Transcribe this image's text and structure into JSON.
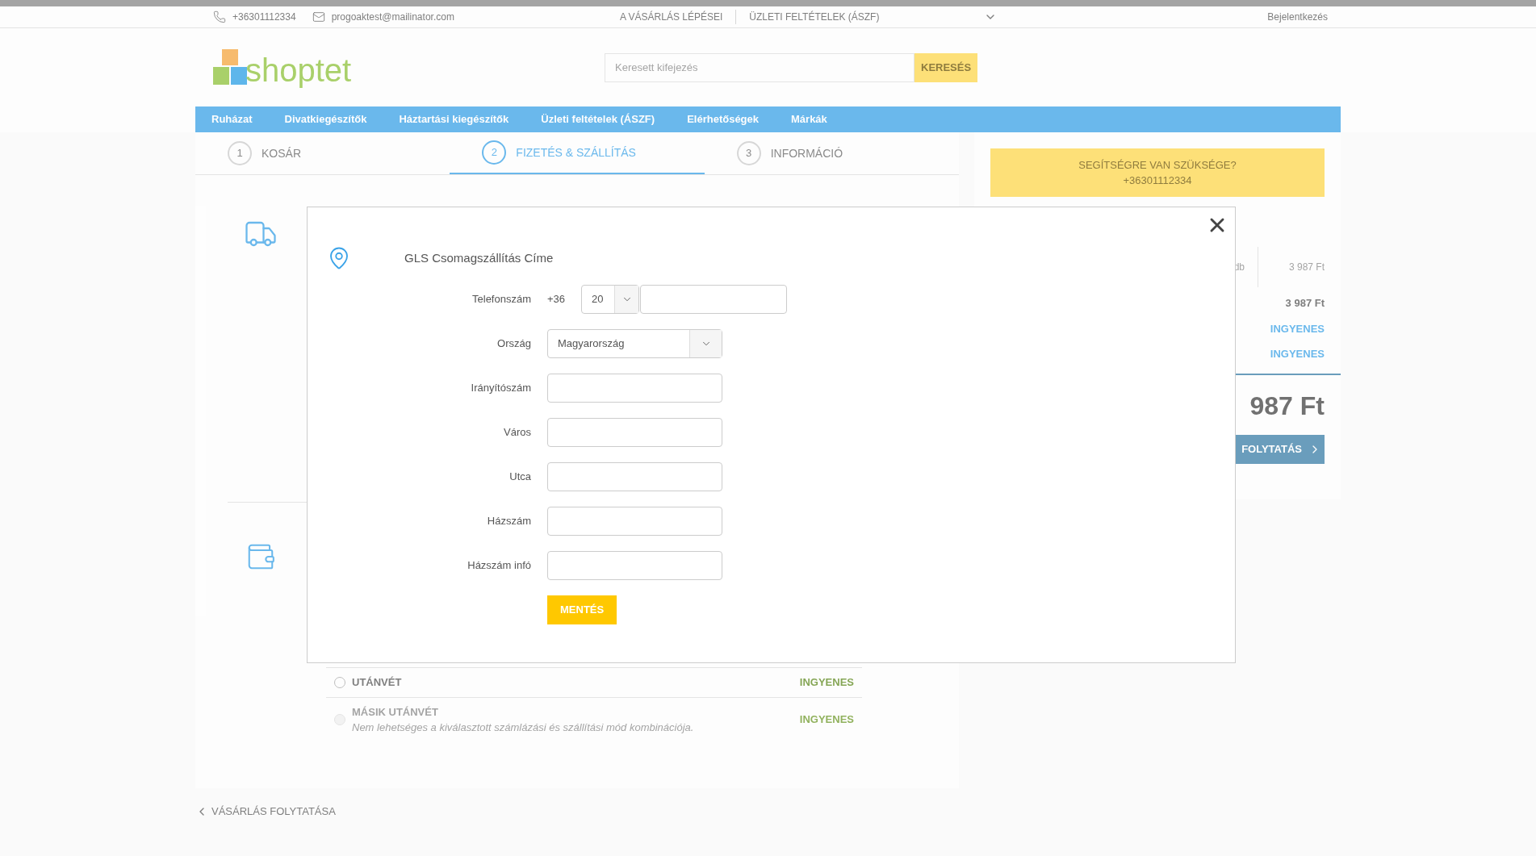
{
  "top_bar": {
    "phone": "+36301112334",
    "email": "progoaktest@mailinator.com",
    "links": [
      "A VÁSÁRLÁS LÉPÉSEI",
      "ÜZLETI FELTÉTELEK (ÁSZF)"
    ],
    "login": "Bejelentkezés"
  },
  "header": {
    "logo": "shoptet",
    "search": {
      "placeholder": "Keresett kifejezés",
      "button": "KERESÉS"
    }
  },
  "nav": [
    "Ruházat",
    "Divatkiegészítők",
    "Háztartási kiegészítők",
    "Üzleti feltételek (ÁSZF)",
    "Elérhetőségek",
    "Márkák"
  ],
  "steps": [
    {
      "number": "1",
      "label": "KOSÁR",
      "selected": false
    },
    {
      "number": "2",
      "label": "FIZETÉS & SZÁLLÍTÁS",
      "selected": true
    },
    {
      "number": "3",
      "label": "INFORMÁCIÓ",
      "selected": false
    }
  ],
  "payment_options": [
    {
      "name": "UTÁNVÉT",
      "price": "INGYENES",
      "disabled": false,
      "selected": false
    },
    {
      "name": "MÁSIK UTÁNVÉT",
      "note": "Nem lehetséges a kiválasztott számlázási és szállítási mód kombinációja.",
      "price": "INGYENES",
      "disabled": true,
      "selected": false
    }
  ],
  "back_link": "VÁSÁRLÁS FOLYTATÁSA",
  "summary": {
    "help_title": "SEGÍTSÉGRE VAN SZÜKSÉGE?",
    "help_phone": "+36301112334",
    "item_qty": "db",
    "item_price": "3 987 Ft",
    "lines": [
      {
        "value": "3 987 Ft",
        "kind": "price"
      },
      {
        "value": "INGYENES",
        "kind": "free"
      },
      {
        "value": "INGYENES",
        "kind": "free"
      }
    ],
    "total": "987 Ft",
    "continue_button": "FOLYTATÁS"
  },
  "modal": {
    "title": "GLS Csomagszállítás Címe",
    "fields": [
      {
        "kind": "phone",
        "label": "Telefonszám",
        "prefix": "+36",
        "area_code": "20"
      },
      {
        "kind": "select",
        "label": "Ország",
        "value": "Magyarország"
      },
      {
        "kind": "text",
        "label": "Irányítószám"
      },
      {
        "kind": "text",
        "label": "Város"
      },
      {
        "kind": "text",
        "label": "Utca"
      },
      {
        "kind": "text",
        "label": "Házszám"
      },
      {
        "kind": "text",
        "label": "Házszám infó"
      }
    ],
    "save_button": "MENTÉS"
  }
}
